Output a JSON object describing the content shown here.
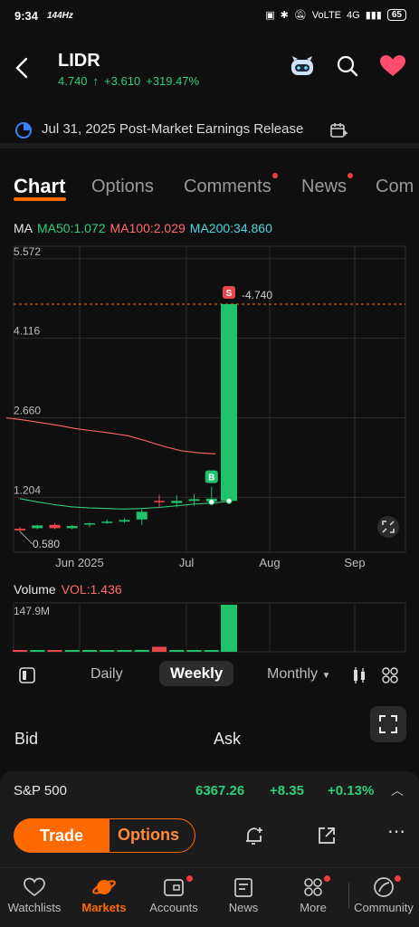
{
  "status": {
    "time": "9:34",
    "refresh": "144Hz",
    "network": "VoLTE",
    "signal": "4G",
    "battery": "65"
  },
  "header": {
    "ticker": "LIDR",
    "price": "4.740",
    "arrow": "↑",
    "change": "+3.610",
    "change_pct": "+319.47%"
  },
  "earnings": {
    "text": "Jul 31, 2025 Post-Market Earnings Release"
  },
  "tabs": [
    {
      "label": "Chart",
      "active": true,
      "dot": false
    },
    {
      "label": "Options",
      "active": false,
      "dot": false
    },
    {
      "label": "Comments",
      "active": false,
      "dot": true
    },
    {
      "label": "News",
      "active": false,
      "dot": true
    },
    {
      "label": "Com",
      "active": false,
      "dot": false
    }
  ],
  "ma": {
    "label": "MA",
    "ma50": "MA50:1.072",
    "ma100": "MA100:2.029",
    "ma200": "MA200:34.860"
  },
  "chart_data": {
    "type": "candlestick",
    "y_ticks": [
      "5.572",
      "4.116",
      "2.660",
      "1.204"
    ],
    "x_ticks": [
      "Jun 2025",
      "Jul",
      "Aug",
      "Sep"
    ],
    "last_price_label": "4.740",
    "low_label": "0.580",
    "sell_marker": "S",
    "buy_marker": "B",
    "candles": [
      {
        "o": 0.63,
        "h": 0.66,
        "l": 0.58,
        "c": 0.6
      },
      {
        "o": 0.64,
        "h": 0.7,
        "l": 0.62,
        "c": 0.69
      },
      {
        "o": 0.7,
        "h": 0.73,
        "l": 0.62,
        "c": 0.64
      },
      {
        "o": 0.64,
        "h": 0.7,
        "l": 0.62,
        "c": 0.68
      },
      {
        "o": 0.71,
        "h": 0.74,
        "l": 0.66,
        "c": 0.73
      },
      {
        "o": 0.74,
        "h": 0.8,
        "l": 0.72,
        "c": 0.76
      },
      {
        "o": 0.76,
        "h": 0.82,
        "l": 0.74,
        "c": 0.79
      },
      {
        "o": 0.8,
        "h": 0.99,
        "l": 0.7,
        "c": 0.94
      },
      {
        "o": 1.14,
        "h": 1.25,
        "l": 1.0,
        "c": 1.12
      },
      {
        "o": 1.1,
        "h": 1.24,
        "l": 1.02,
        "c": 1.14
      },
      {
        "o": 1.14,
        "h": 1.26,
        "l": 1.05,
        "c": 1.17
      },
      {
        "o": 1.13,
        "h": 1.4,
        "l": 1.07,
        "c": 1.18
      },
      {
        "o": 1.14,
        "h": 4.74,
        "l": 1.13,
        "c": 4.74
      }
    ],
    "y_range": [
      0.2,
      5.8
    ],
    "ma50_line": [
      1.18,
      1.12,
      1.07,
      1.03,
      1.01,
      1.0,
      0.99,
      1.0,
      1.02,
      1.05,
      1.08,
      1.1,
      1.13
    ],
    "ma100_line": [
      2.66,
      2.62,
      2.57,
      2.52,
      2.46,
      2.42,
      2.38,
      2.33,
      2.24,
      2.14,
      2.06,
      2.02,
      2.0
    ],
    "volume_label": "Volume",
    "vol_value": "VOL:1.436",
    "vol_ytick": "147.9M",
    "volumes": [
      3,
      2.5,
      3,
      2.5,
      2,
      3,
      4,
      6,
      16,
      5,
      4,
      4,
      150
    ]
  },
  "period": {
    "daily": "Daily",
    "weekly": "Weekly",
    "monthly": "Monthly"
  },
  "bidask": {
    "bid": "Bid",
    "ask": "Ask"
  },
  "index": {
    "name": "S&P 500",
    "value": "6367.26",
    "change": "+8.35",
    "pct": "+0.13%"
  },
  "actions": {
    "trade": "Trade",
    "options": "Options"
  },
  "nav": [
    {
      "label": "Watchlists",
      "icon": "heart-outline-icon",
      "active": false,
      "dot": false
    },
    {
      "label": "Markets",
      "icon": "planet-icon",
      "active": true,
      "dot": false
    },
    {
      "label": "Accounts",
      "icon": "wallet-icon",
      "active": false,
      "dot": true
    },
    {
      "label": "News",
      "icon": "news-icon",
      "active": false,
      "dot": false
    },
    {
      "label": "More",
      "icon": "grid-icon",
      "active": false,
      "dot": true
    },
    {
      "label": "Community",
      "icon": "community-icon",
      "active": false,
      "dot": true
    }
  ],
  "colors": {
    "up": "#1fc16b",
    "down": "#e8464d",
    "accent": "#ff6a00",
    "ma50": "#2fce7a",
    "ma100": "#ff6b6b",
    "ma200": "#4fd3e0"
  }
}
